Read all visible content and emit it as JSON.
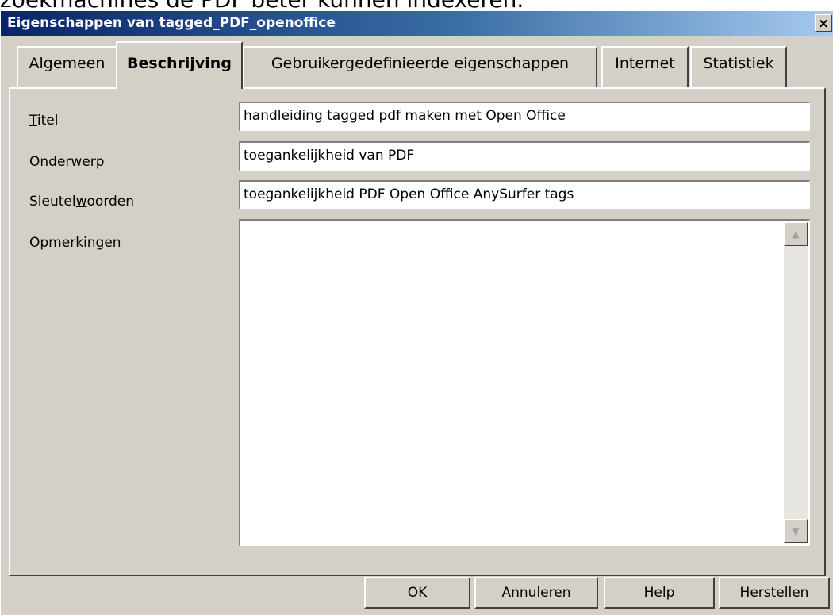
{
  "background_text": "zoekmachines de PDF beter kunnen indexeren.",
  "window": {
    "title": "Eigenschappen van tagged_PDF_openoffice",
    "close_label": "×"
  },
  "tabs": [
    {
      "label": "Algemeen"
    },
    {
      "label": "Beschrijving",
      "active": true
    },
    {
      "label": "Gebruikergedefinieerde eigenschappen"
    },
    {
      "label": "Internet"
    },
    {
      "label": "Statistiek"
    }
  ],
  "fields": {
    "title": {
      "label_pre": "",
      "label_key": "T",
      "label_post": "itel",
      "value": "handleiding tagged pdf maken met Open Office"
    },
    "subject": {
      "label_pre": "",
      "label_key": "O",
      "label_post": "nderwerp",
      "value": "toegankelijkheid van PDF"
    },
    "keywords": {
      "label_pre": "Sleutel",
      "label_key": "w",
      "label_post": "oorden",
      "value": "toegankelijkheid PDF Open Office AnySurfer tags"
    },
    "comments": {
      "label_pre": "",
      "label_key": "O",
      "label_post": "pmerkingen",
      "value": ""
    }
  },
  "buttons": {
    "ok": "OK",
    "cancel": "Annuleren",
    "help_pre": "",
    "help_key": "H",
    "help_post": "elp",
    "reset_pre": "Her",
    "reset_key": "s",
    "reset_post": "tellen"
  }
}
